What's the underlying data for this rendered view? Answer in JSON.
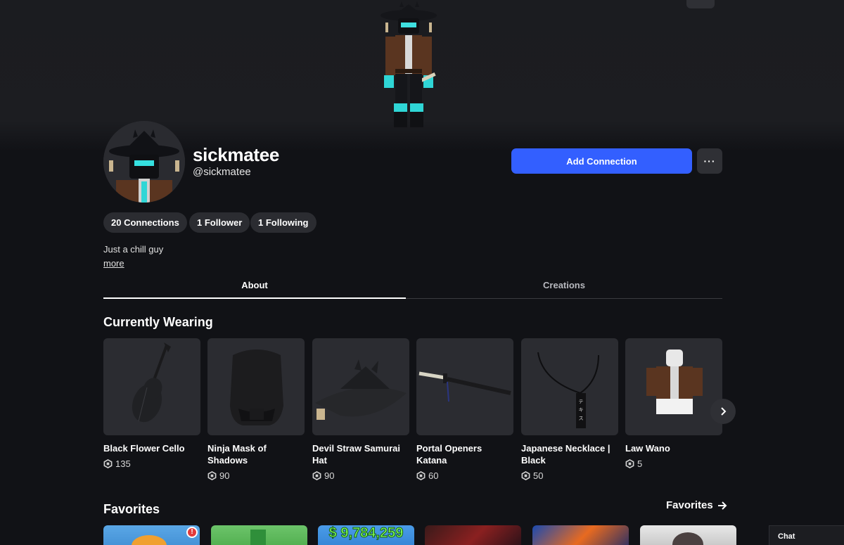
{
  "profile": {
    "display_name": "sickmatee",
    "username": "@sickmatee",
    "bio": "Just a chill guy",
    "more_label": "more",
    "add_connection_label": "Add Connection",
    "more_options_label": "···"
  },
  "stats": {
    "connections": "20 Connections",
    "followers": "1 Follower",
    "following": "1 Following"
  },
  "tabs": [
    {
      "label": "About",
      "active": true
    },
    {
      "label": "Creations",
      "active": false
    }
  ],
  "wearing": {
    "title": "Currently Wearing",
    "items": [
      {
        "name": "Black Flower Cello",
        "price": "135"
      },
      {
        "name": "Ninja Mask of Shadows",
        "price": "90"
      },
      {
        "name": "Devil Straw Samurai Hat",
        "price": "90"
      },
      {
        "name": "Portal Openers Katana",
        "price": "60"
      },
      {
        "name": "Japanese Necklace | Black",
        "price": "50"
      },
      {
        "name": "Law Wano",
        "price": "5"
      }
    ]
  },
  "favorites": {
    "title": "Favorites",
    "link_label": "Favorites",
    "tile_text_3": "$ 9,784,259"
  },
  "chat": {
    "label": "Chat"
  },
  "icons": {
    "robux": "robux-icon",
    "next": "chevron-right-icon",
    "arrow": "arrow-right-icon"
  },
  "colors": {
    "accent": "#335fff",
    "background": "#111216",
    "surface": "#2b2c31"
  }
}
